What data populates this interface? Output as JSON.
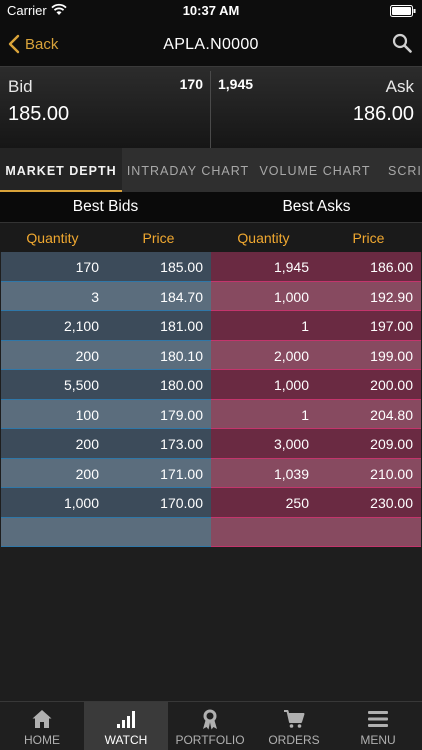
{
  "status_bar": {
    "carrier": "Carrier",
    "time": "10:37 AM"
  },
  "nav": {
    "back_label": "Back",
    "title": "APLA.N0000"
  },
  "quote": {
    "bid_label": "Bid",
    "bid_size": "170",
    "bid_price": "185.00",
    "ask_label": "Ask",
    "ask_size": "1,945",
    "ask_price": "186.00"
  },
  "tabs": [
    {
      "label": "MARKET DEPTH"
    },
    {
      "label": "INTRADAY CHART"
    },
    {
      "label": "VOLUME CHART"
    },
    {
      "label": "SCRIP"
    }
  ],
  "book": {
    "bids_title": "Best Bids",
    "asks_title": "Best Asks",
    "columns": {
      "bid_qty": "Quantity",
      "bid_price": "Price",
      "ask_qty": "Quantity",
      "ask_price": "Price"
    },
    "rows": [
      {
        "bq": "170",
        "bp": "185.00",
        "aq": "1,945",
        "ap": "186.00"
      },
      {
        "bq": "3",
        "bp": "184.70",
        "aq": "1,000",
        "ap": "192.90"
      },
      {
        "bq": "2,100",
        "bp": "181.00",
        "aq": "1",
        "ap": "197.00"
      },
      {
        "bq": "200",
        "bp": "180.10",
        "aq": "2,000",
        "ap": "199.00"
      },
      {
        "bq": "5,500",
        "bp": "180.00",
        "aq": "1,000",
        "ap": "200.00"
      },
      {
        "bq": "100",
        "bp": "179.00",
        "aq": "1",
        "ap": "204.80"
      },
      {
        "bq": "200",
        "bp": "173.00",
        "aq": "3,000",
        "ap": "209.00"
      },
      {
        "bq": "200",
        "bp": "171.00",
        "aq": "1,039",
        "ap": "210.00"
      },
      {
        "bq": "1,000",
        "bp": "170.00",
        "aq": "250",
        "ap": "230.00"
      },
      {
        "bq": "",
        "bp": "",
        "aq": "",
        "ap": ""
      }
    ]
  },
  "tabbar": [
    {
      "label": "HOME",
      "icon": "home-icon"
    },
    {
      "label": "WATCH",
      "icon": "bar-chart-icon"
    },
    {
      "label": "PORTFOLIO",
      "icon": "award-ribbon-icon"
    },
    {
      "label": "ORDERS",
      "icon": "cart-icon"
    },
    {
      "label": "MENU",
      "icon": "hamburger-menu-icon"
    }
  ],
  "colors": {
    "accent": "#d9a33a",
    "column_header": "#f0a830",
    "bid_row": "#3c4b5a",
    "ask_row": "#6a2a42"
  }
}
